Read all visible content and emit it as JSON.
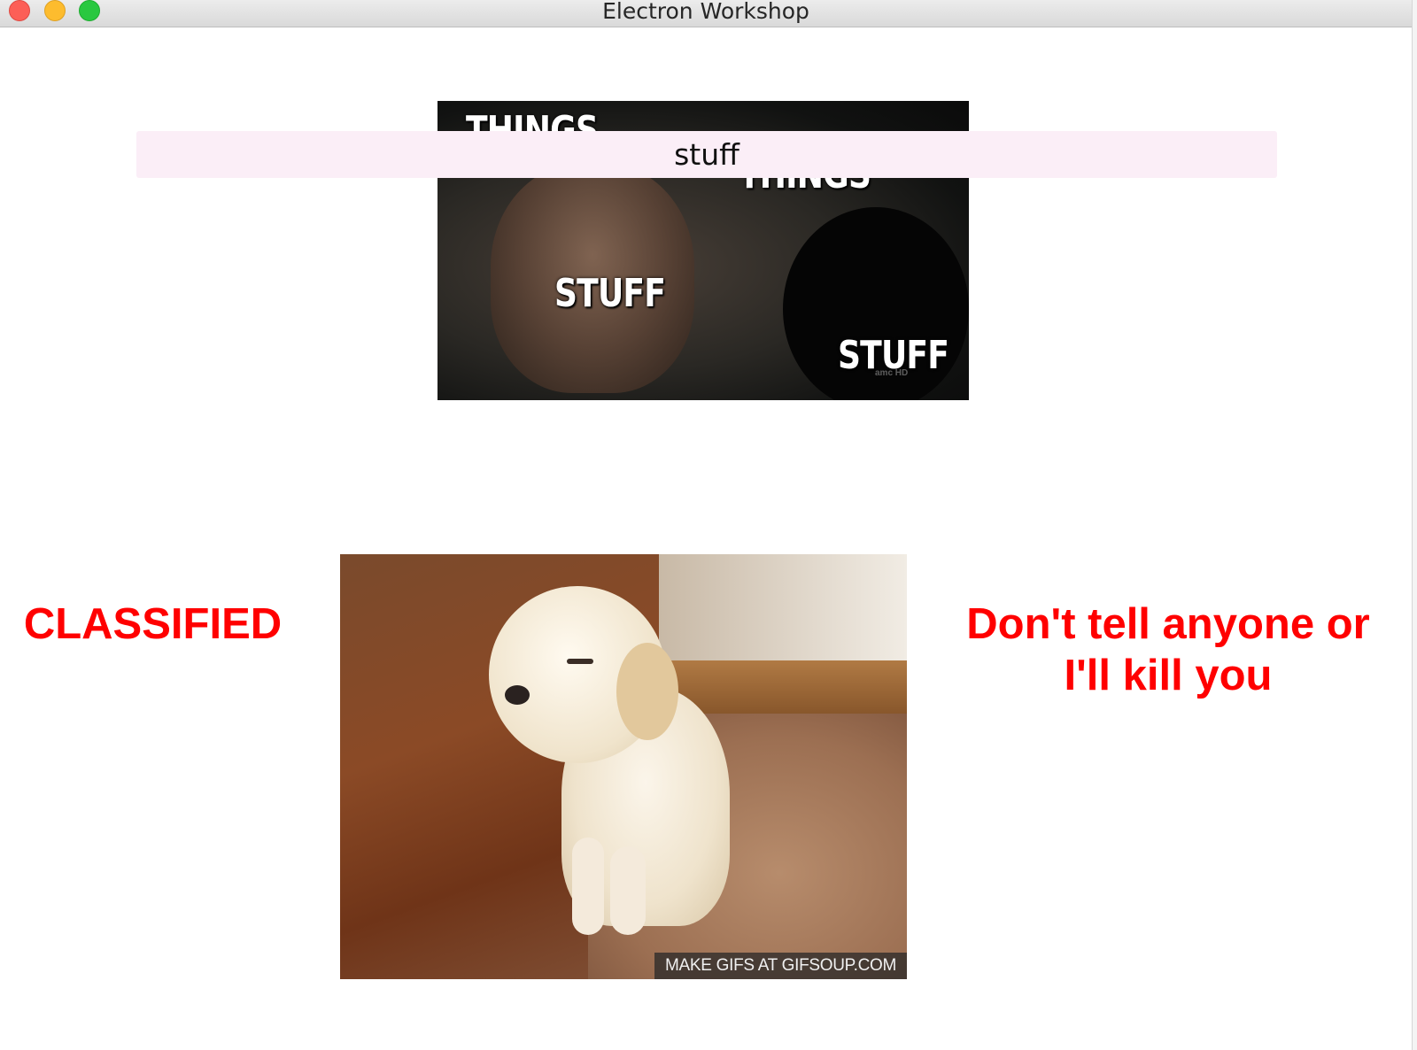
{
  "window": {
    "title": "Electron Workshop"
  },
  "search": {
    "value": "stuff"
  },
  "top_gif": {
    "words": [
      "THINGS",
      "THINGS",
      "STUFF",
      "STUFF"
    ],
    "logo": "amc HD"
  },
  "bottom_gif": {
    "watermark": "MAKE GIFS AT GIFSOUP.COM"
  },
  "captions": {
    "left": "CLASSIFIED",
    "right": "Don't tell anyone or I'll kill you"
  },
  "colors": {
    "caption": "#ff0000",
    "search_bg": "#fbeef7"
  },
  "icons": {
    "close": "close-icon",
    "minimize": "minimize-icon",
    "maximize": "maximize-icon"
  }
}
